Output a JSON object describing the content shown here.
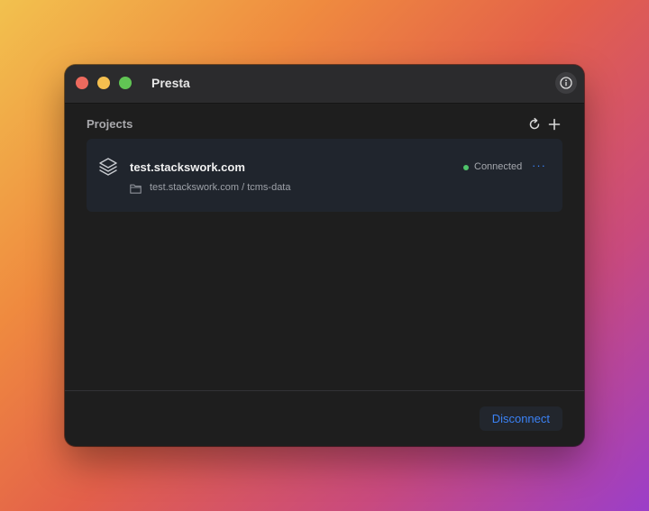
{
  "window": {
    "app_title": "Presta"
  },
  "projects": {
    "section_title": "Projects",
    "items": [
      {
        "name": "test.stackswork.com",
        "status": "Connected",
        "path": "test.stackswork.com / tcms-data",
        "more": "···"
      }
    ]
  },
  "footer": {
    "disconnect_label": "Disconnect"
  },
  "colors": {
    "accent": "#3b82f6",
    "status_connected": "#4fc36a",
    "window_bg": "#1e1e1e",
    "card_bg": "#20252d"
  },
  "icons": {
    "info": "info-icon",
    "refresh": "refresh-icon",
    "add": "plus-icon",
    "project": "layers-icon",
    "folder": "folder-icon",
    "more": "ellipsis-icon"
  }
}
